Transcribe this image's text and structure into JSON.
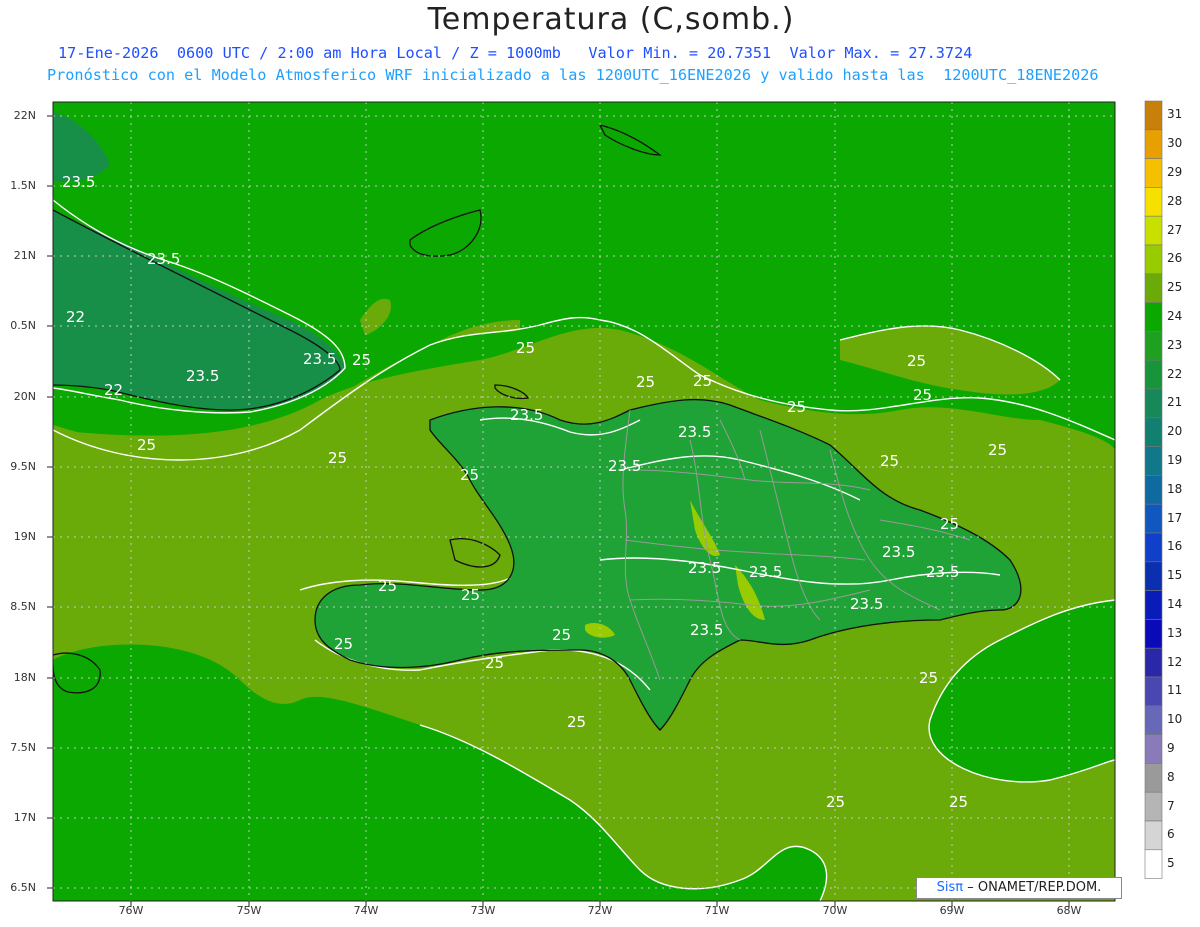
{
  "title": "Temperatura (C,somb.)",
  "subtitle1": "17-Ene-2026  0600 UTC / 2:00 am Hora Local / Z = 1000mb   Valor Min. = 20.7351  Valor Max. = 27.3724",
  "subtitle2": "Pronóstico con el Modelo Atmosferico WRF inicializado a las 1200UTC_16ENE2026 y valido hasta las  1200UTC_18ENE2026",
  "lat_labels": [
    "22N",
    "1.5N",
    "21N",
    "0.5N",
    "20N",
    "9.5N",
    "19N",
    "8.5N",
    "18N",
    "7.5N",
    "17N",
    "6.5N"
  ],
  "lon_labels": [
    "76W",
    "75W",
    "74W",
    "73W",
    "72W",
    "71W",
    "70W",
    "69W",
    "68W"
  ],
  "colorbar": {
    "levels": [
      "31",
      "30",
      "29",
      "28",
      "27",
      "26",
      "25",
      "24",
      "23",
      "22",
      "21",
      "20",
      "19",
      "18",
      "17",
      "16",
      "15",
      "14",
      "13",
      "12",
      "11",
      "10",
      "9",
      "8",
      "7",
      "6",
      "5"
    ],
    "colors": [
      "#c8800a",
      "#e8a000",
      "#f5c000",
      "#f5e000",
      "#c8e000",
      "#99cc00",
      "#6aab0a",
      "#0aa800",
      "#20a020",
      "#18953a",
      "#16885a",
      "#128070",
      "#107888",
      "#0f6aa0",
      "#1058c0",
      "#1040c8",
      "#0a30b0",
      "#0a1cb8",
      "#0a0ab8",
      "#2828a8",
      "#4848b0",
      "#6868b8",
      "#8a7ab8",
      "#9a9a9a",
      "#b5b5b5",
      "#d5d5d5",
      "#ffffff"
    ]
  },
  "contour_labels": [
    "23.5",
    "23.5",
    "22",
    "22",
    "23.5",
    "25",
    "25",
    "25",
    "25",
    "25",
    "25",
    "25",
    "23.5",
    "23.5",
    "23.5",
    "25",
    "25",
    "25",
    "25",
    "23.5",
    "23.5",
    "23.5",
    "23.5",
    "25",
    "25",
    "25",
    "25",
    "25",
    "25",
    "25",
    "25",
    "25",
    "25",
    "25",
    "23.5",
    "23.5",
    "23.5"
  ],
  "colors": {
    "sea": "#0aa800",
    "warm": "#6aab0a",
    "land": "#1fa236",
    "cool": "#188f48"
  },
  "credit": {
    "brand": "Sisπ",
    "text": "– ONAMET/REP.DOM."
  }
}
